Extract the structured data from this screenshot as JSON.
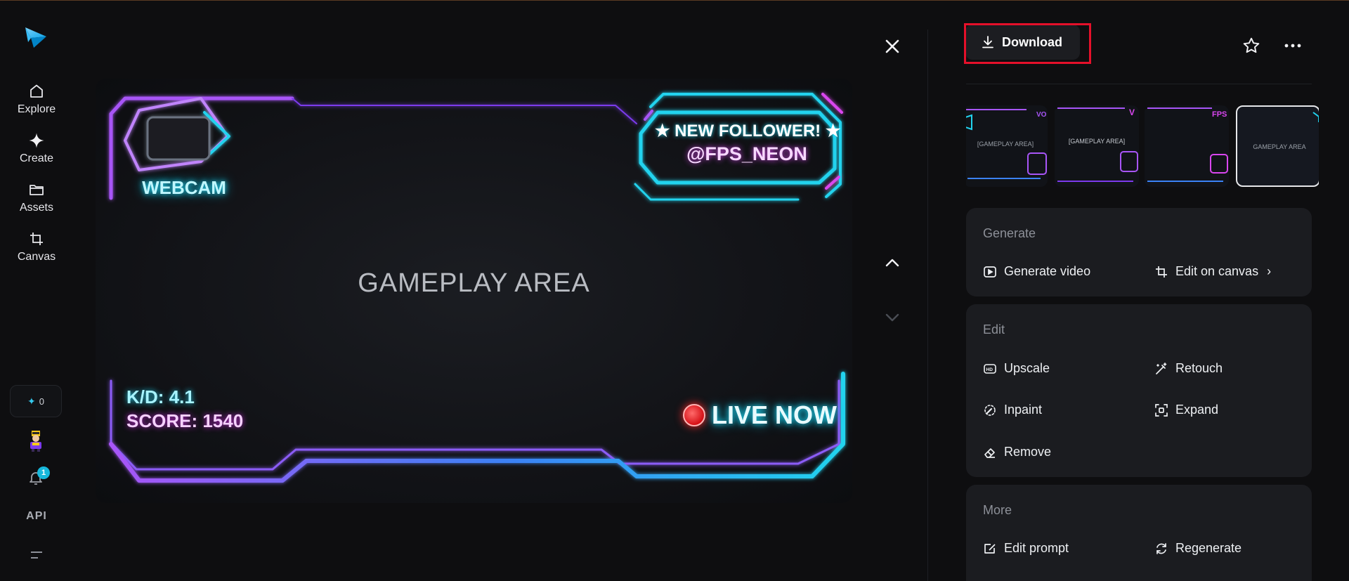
{
  "rail": {
    "items": [
      {
        "label": "Explore",
        "icon": "home-icon"
      },
      {
        "label": "Create",
        "icon": "sparkle-icon"
      },
      {
        "label": "Assets",
        "icon": "folder-icon"
      },
      {
        "label": "Canvas",
        "icon": "crop-icon"
      }
    ],
    "credits": {
      "icon": "✦",
      "value": "0"
    },
    "notifications_badge": "1",
    "api_label": "API"
  },
  "preview": {
    "gameplay_label": "GAMEPLAY AREA",
    "webcam_label": "WEBCAM",
    "follower_line1": "★ NEW FOLLOWER! ★",
    "follower_line2": "@FPS_NEON",
    "kd": "K/D: 4.1",
    "score": "SCORE: 1540",
    "live": "LIVE NOW"
  },
  "toolbar": {
    "download_label": "Download"
  },
  "thumbnails": [
    {
      "label": "[GAMEPLAY AREA]",
      "selected": false
    },
    {
      "label": "[GAMEPLAY AREA]",
      "selected": false
    },
    {
      "label": "",
      "selected": false
    },
    {
      "label": "GAMEPLAY AREA",
      "selected": true
    }
  ],
  "sections": {
    "generate": {
      "title": "Generate",
      "actions": [
        "Generate video",
        "Edit on canvas"
      ]
    },
    "edit": {
      "title": "Edit",
      "actions": [
        "Upscale",
        "Retouch",
        "Inpaint",
        "Expand",
        "Remove"
      ]
    },
    "more": {
      "title": "More",
      "actions": [
        "Edit prompt",
        "Regenerate"
      ]
    }
  },
  "colors": {
    "accent_cyan": "#22d3ee",
    "accent_purple": "#a855f7",
    "highlight_red": "#e5102a",
    "background": "#0e0e10",
    "card": "#1b1c20"
  }
}
